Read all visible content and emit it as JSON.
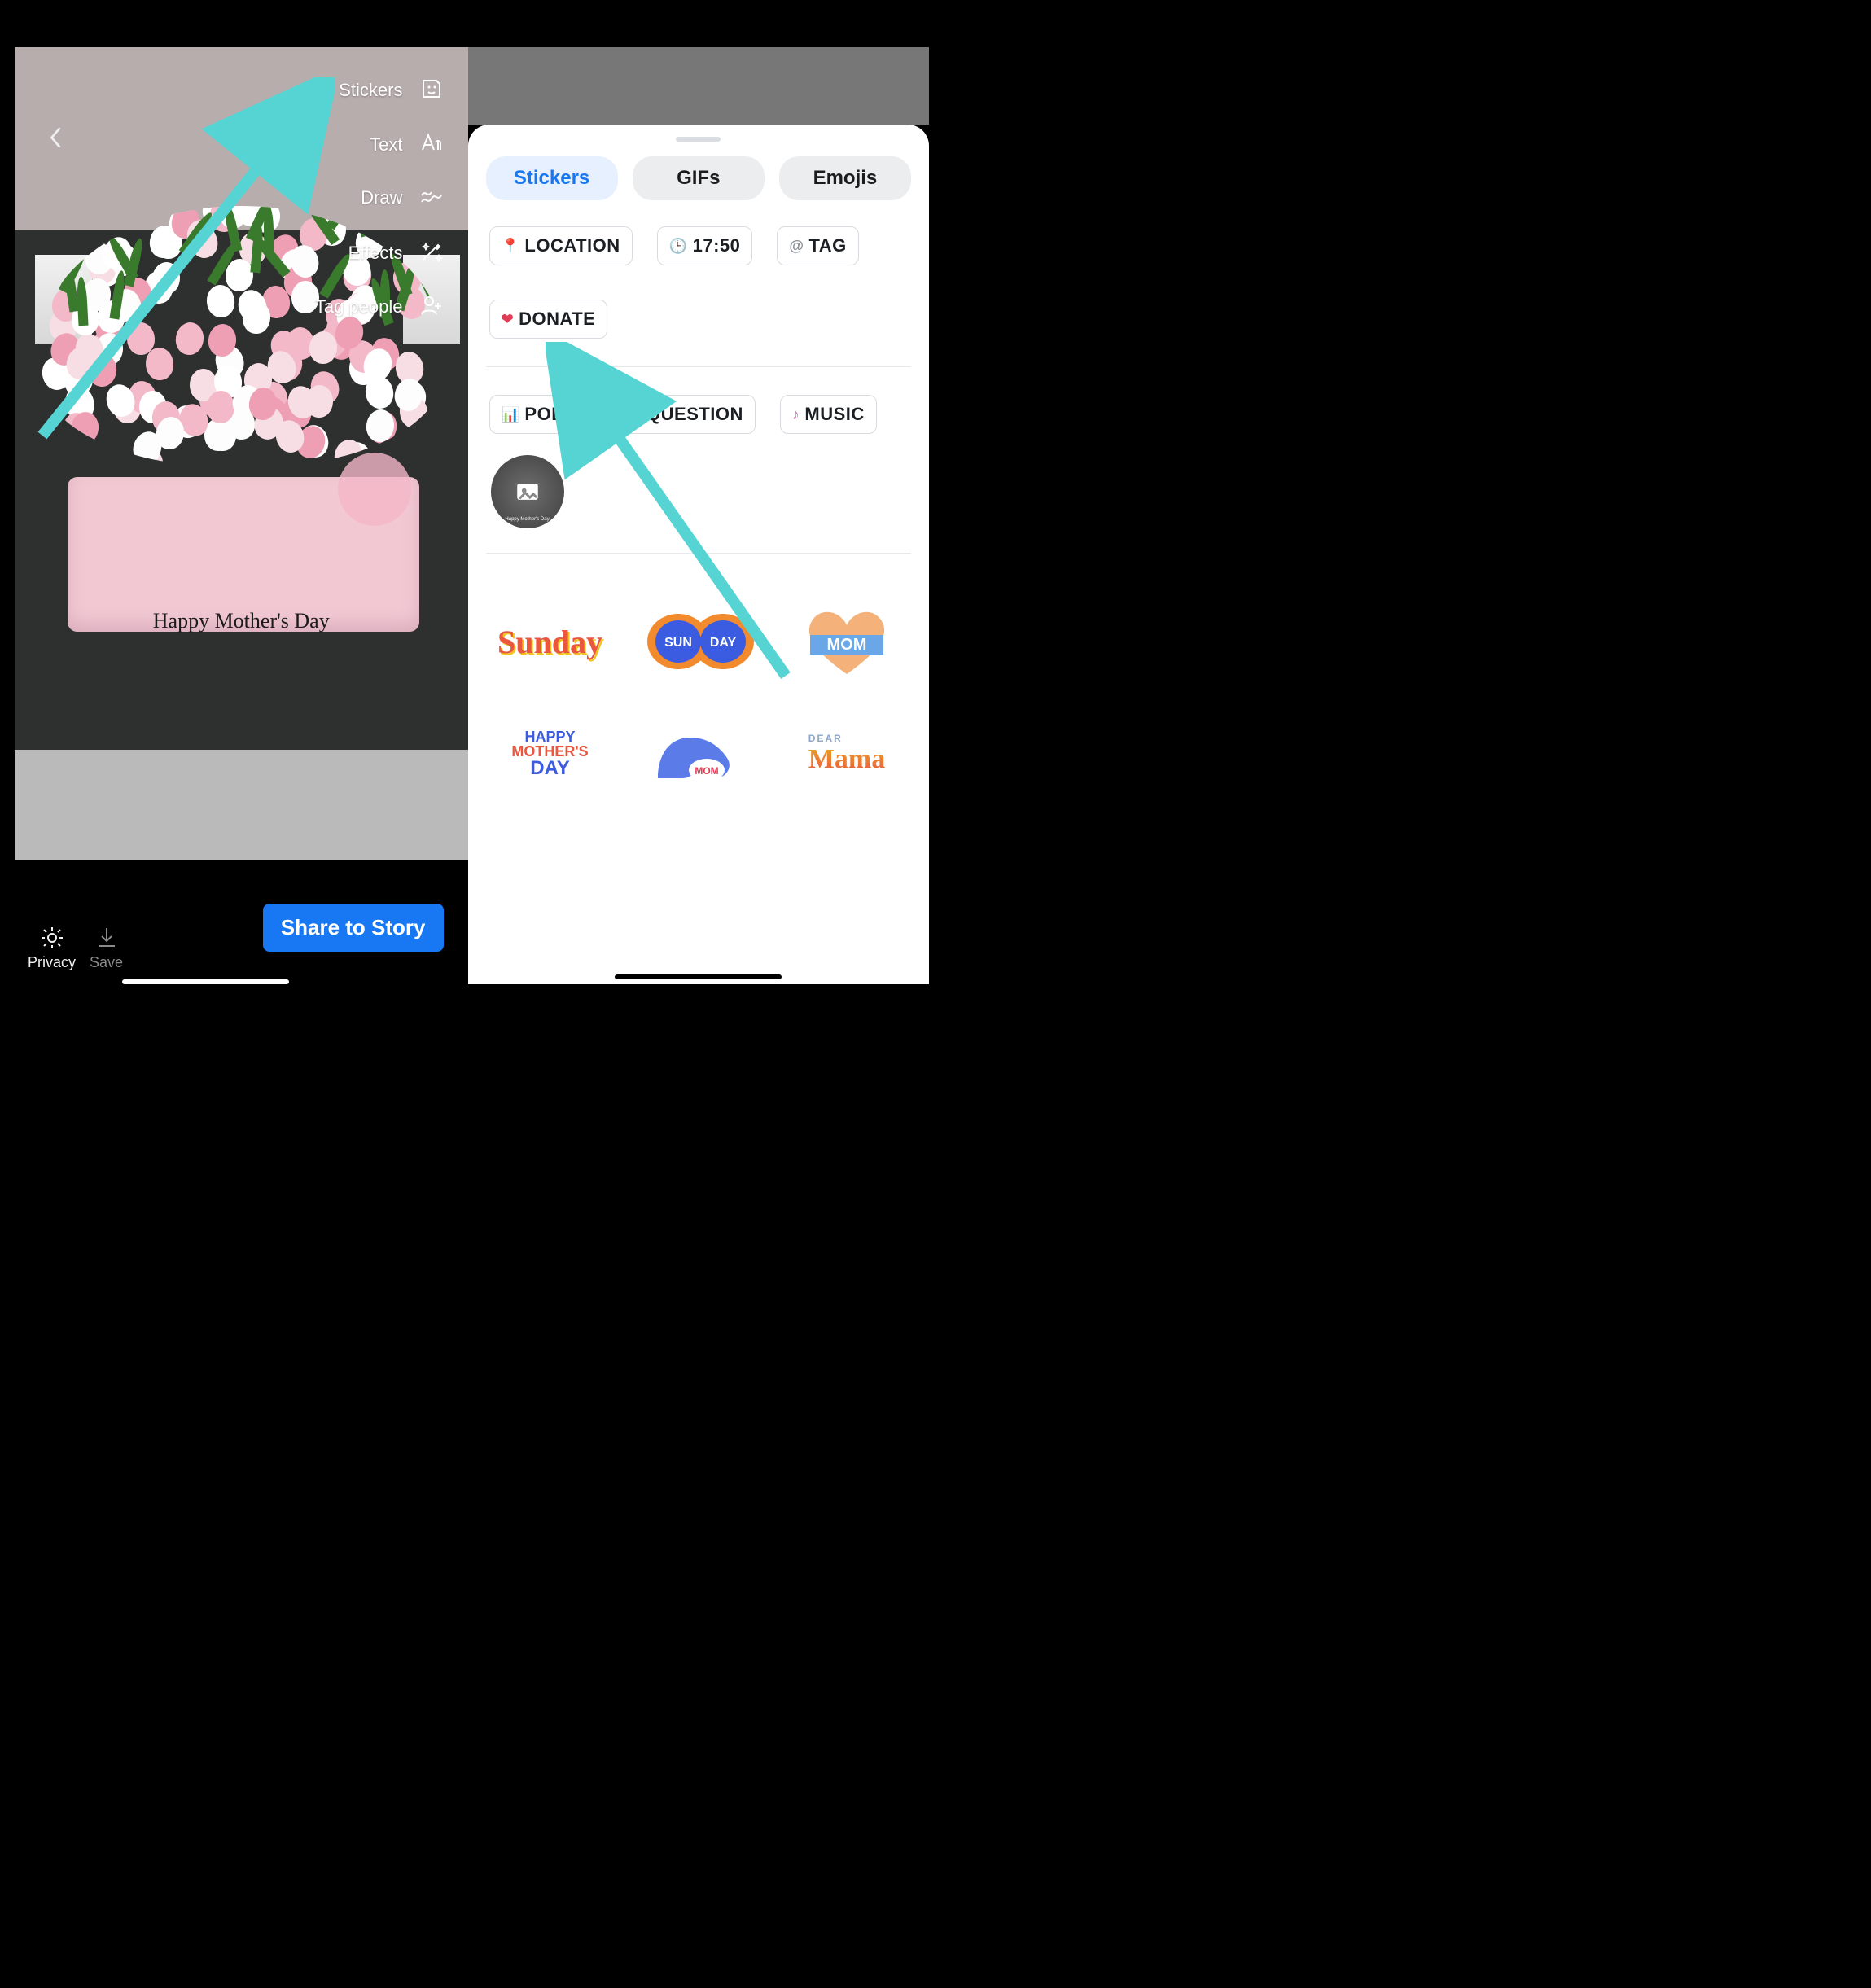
{
  "left": {
    "tools": {
      "stickers": "Stickers",
      "text": "Text",
      "draw": "Draw",
      "effects": "Effects",
      "tag_people": "Tag people"
    },
    "caption": "Happy Mother's Day",
    "bottom": {
      "privacy": "Privacy",
      "save": "Save",
      "share": "Share to Story"
    }
  },
  "right": {
    "tabs": {
      "stickers": "Stickers",
      "gifs": "GIFs",
      "emojis": "Emojis"
    },
    "chips": {
      "location": "LOCATION",
      "time": "17:50",
      "tag": "TAG",
      "donate": "DONATE",
      "poll": "POLL",
      "question": "QUESTION",
      "music": "MUSIC"
    },
    "thumb_caption": "Happy Mother's Day",
    "stickers_row1": {
      "sunday": "Sunday",
      "sunday2": "SUN DAY",
      "mom": "MOM"
    },
    "stickers_row2": {
      "hmd": "HAPPY MOTHER'S DAY",
      "arm": "MOM",
      "mama": "Dear Mama"
    }
  },
  "colors": {
    "accent": "#1877F2",
    "arrow": "#56D3D3"
  }
}
